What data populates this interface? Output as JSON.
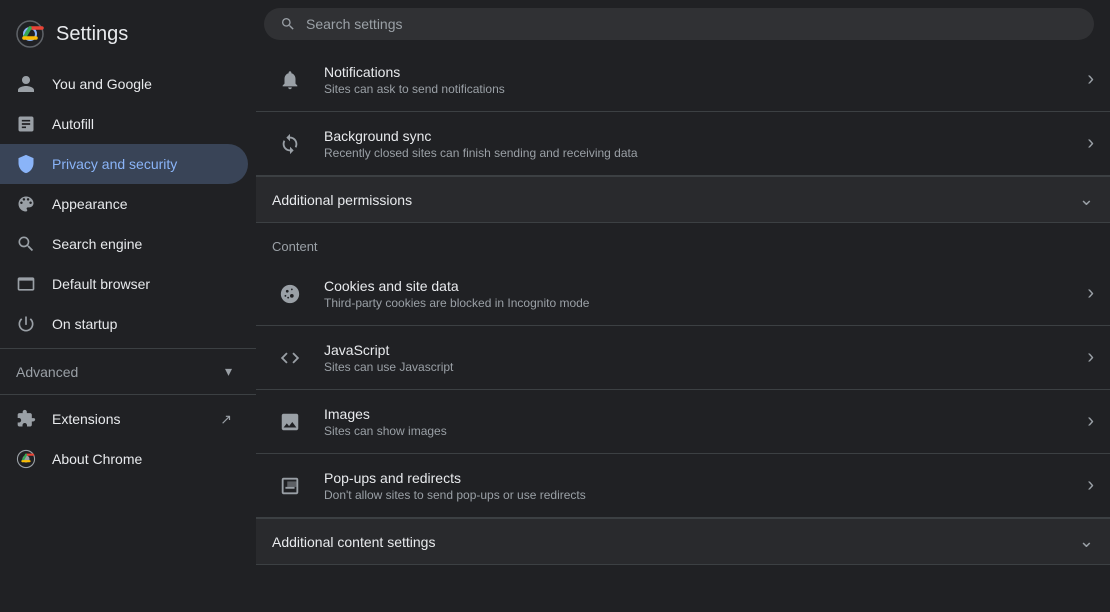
{
  "app": {
    "title": "Settings",
    "search_placeholder": "Search settings"
  },
  "sidebar": {
    "items": [
      {
        "id": "you-and-google",
        "label": "You and Google",
        "icon": "person"
      },
      {
        "id": "autofill",
        "label": "Autofill",
        "icon": "autofill"
      },
      {
        "id": "privacy-and-security",
        "label": "Privacy and security",
        "icon": "shield",
        "active": true
      },
      {
        "id": "appearance",
        "label": "Appearance",
        "icon": "palette"
      },
      {
        "id": "search-engine",
        "label": "Search engine",
        "icon": "search"
      },
      {
        "id": "default-browser",
        "label": "Default browser",
        "icon": "browser"
      },
      {
        "id": "on-startup",
        "label": "On startup",
        "icon": "power"
      }
    ],
    "advanced_label": "Advanced",
    "extensions_label": "Extensions",
    "about_chrome_label": "About Chrome"
  },
  "content": {
    "items": [
      {
        "id": "notifications",
        "title": "Notifications",
        "subtitle": "Sites can ask to send notifications",
        "icon": "bell"
      },
      {
        "id": "background-sync",
        "title": "Background sync",
        "subtitle": "Recently closed sites can finish sending and receiving data",
        "icon": "sync"
      }
    ],
    "additional_permissions_label": "Additional permissions",
    "content_section_label": "Content",
    "content_items": [
      {
        "id": "cookies",
        "title": "Cookies and site data",
        "subtitle": "Third-party cookies are blocked in Incognito mode",
        "icon": "cookie"
      },
      {
        "id": "javascript",
        "title": "JavaScript",
        "subtitle": "Sites can use Javascript",
        "icon": "code"
      },
      {
        "id": "images",
        "title": "Images",
        "subtitle": "Sites can show images",
        "icon": "image"
      },
      {
        "id": "popups",
        "title": "Pop-ups and redirects",
        "subtitle": "Don't allow sites to send pop-ups or use redirects",
        "icon": "popup"
      }
    ],
    "additional_content_settings_label": "Additional content settings"
  }
}
